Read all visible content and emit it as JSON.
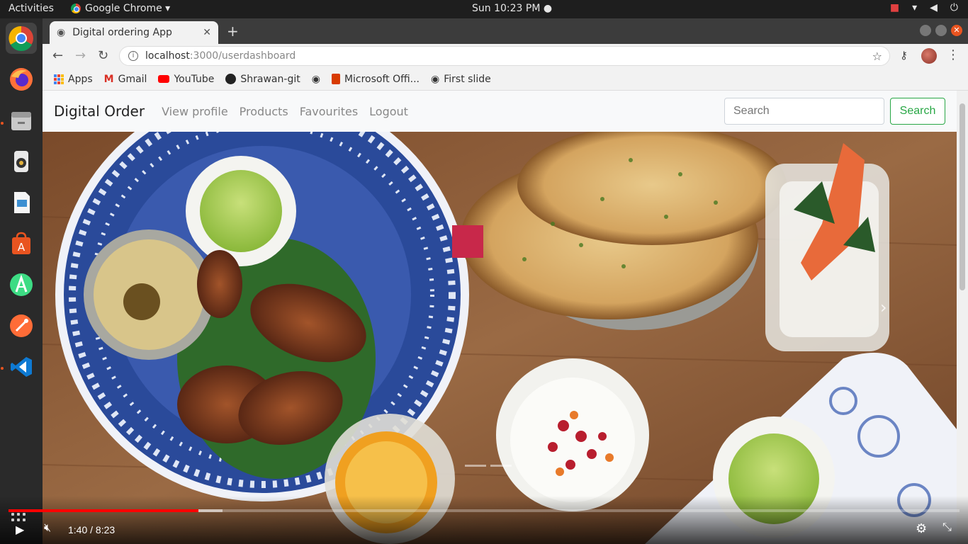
{
  "topbar": {
    "activities": "Activities",
    "app": "Google Chrome ▾",
    "clock": "Sun 10:23 PM ●"
  },
  "dock": {
    "items": [
      "chrome-icon",
      "firefox-icon",
      "files-icon",
      "rhythmbox-icon",
      "libreoffice-impress-icon",
      "software-center-icon",
      "android-studio-icon",
      "postman-icon",
      "vscode-icon"
    ]
  },
  "browser": {
    "tab_title": "Digital ordering App",
    "url_host": "localhost",
    "url_path": ":3000/userdashboard",
    "bookmarks": [
      "Apps",
      "Gmail",
      "YouTube",
      "Shrawan-git",
      "Microsoft Offi...",
      "First slide"
    ]
  },
  "page": {
    "brand": "Digital Order",
    "nav": [
      "View profile",
      "Products",
      "Favourites",
      "Logout"
    ],
    "search_placeholder": "Search",
    "search_button": "Search"
  },
  "video": {
    "time": "1:40 / 8:23",
    "progress": 0.2
  }
}
